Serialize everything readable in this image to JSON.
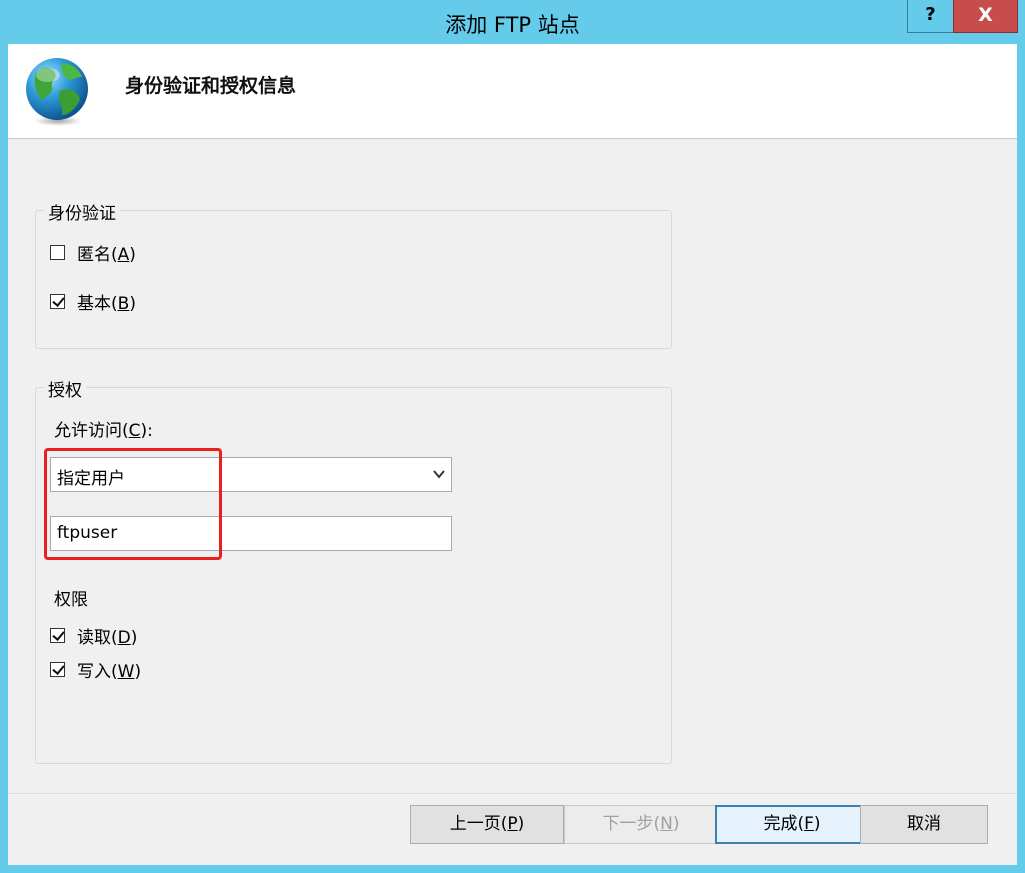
{
  "window": {
    "title": "添加 FTP 站点",
    "help_label": "?",
    "close_label": "X"
  },
  "header": {
    "title": "身份验证和授权信息",
    "icon": "globe-icon"
  },
  "authentication": {
    "legend": "身份验证",
    "anonymous": {
      "label": "匿名",
      "mnemonic": "A",
      "checked": false
    },
    "basic": {
      "label": "基本",
      "mnemonic": "B",
      "checked": true
    }
  },
  "authorization": {
    "legend": "授权",
    "allow_access_label": "允许访问",
    "allow_access_mnemonic": "C",
    "allow_access_select": "指定用户",
    "user_value": "ftpuser",
    "permissions_label": "权限",
    "read": {
      "label": "读取",
      "mnemonic": "D",
      "checked": true
    },
    "write": {
      "label": "写入",
      "mnemonic": "W",
      "checked": true
    }
  },
  "buttons": {
    "previous": {
      "label": "上一页",
      "mnemonic": "P"
    },
    "next": {
      "label": "下一步",
      "mnemonic": "N",
      "disabled": true
    },
    "finish": {
      "label": "完成",
      "mnemonic": "F"
    },
    "cancel": {
      "label": "取消"
    }
  },
  "colors": {
    "title_bar": "#65cbea",
    "close_button": "#c74d4c",
    "highlight_box": "#e8201f",
    "dialog_background": "#f0f0f0"
  }
}
